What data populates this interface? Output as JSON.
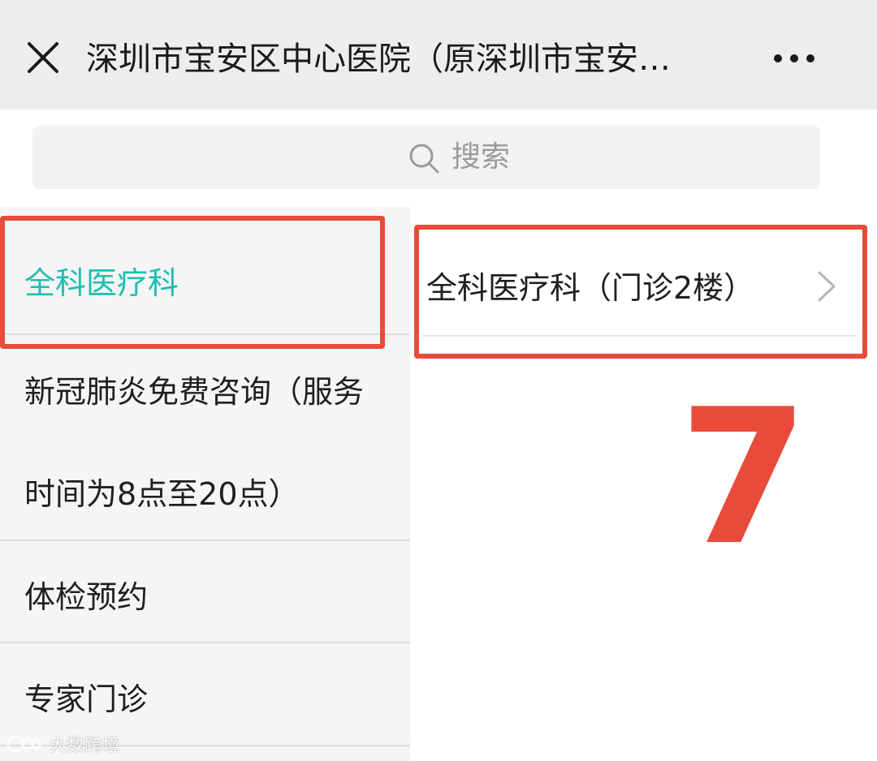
{
  "header": {
    "title": "深圳市宝安区中心医院（原深圳市宝安…",
    "close_icon": "close-icon",
    "more_icon": "more-icon"
  },
  "search": {
    "placeholder": "搜索",
    "icon": "search-icon"
  },
  "sidebar": {
    "items": [
      {
        "label": "全科医疗科",
        "active": true
      },
      {
        "label_line1": "新冠肺炎免费咨询（服务",
        "label_line2": "时间为8点至20点）"
      },
      {
        "label": "体检预约"
      },
      {
        "label": "专家门诊"
      }
    ]
  },
  "content": {
    "items": [
      {
        "label": "全科医疗科（门诊2楼）",
        "icon": "chevron-right-icon"
      }
    ]
  },
  "annotation": {
    "number": "7",
    "color": "#e74c3c"
  },
  "watermark": {
    "text": "大数跨境"
  },
  "colors": {
    "accent": "#1bbfb3",
    "header_bg": "#ededed",
    "sidebar_bg": "#f5f5f5"
  }
}
